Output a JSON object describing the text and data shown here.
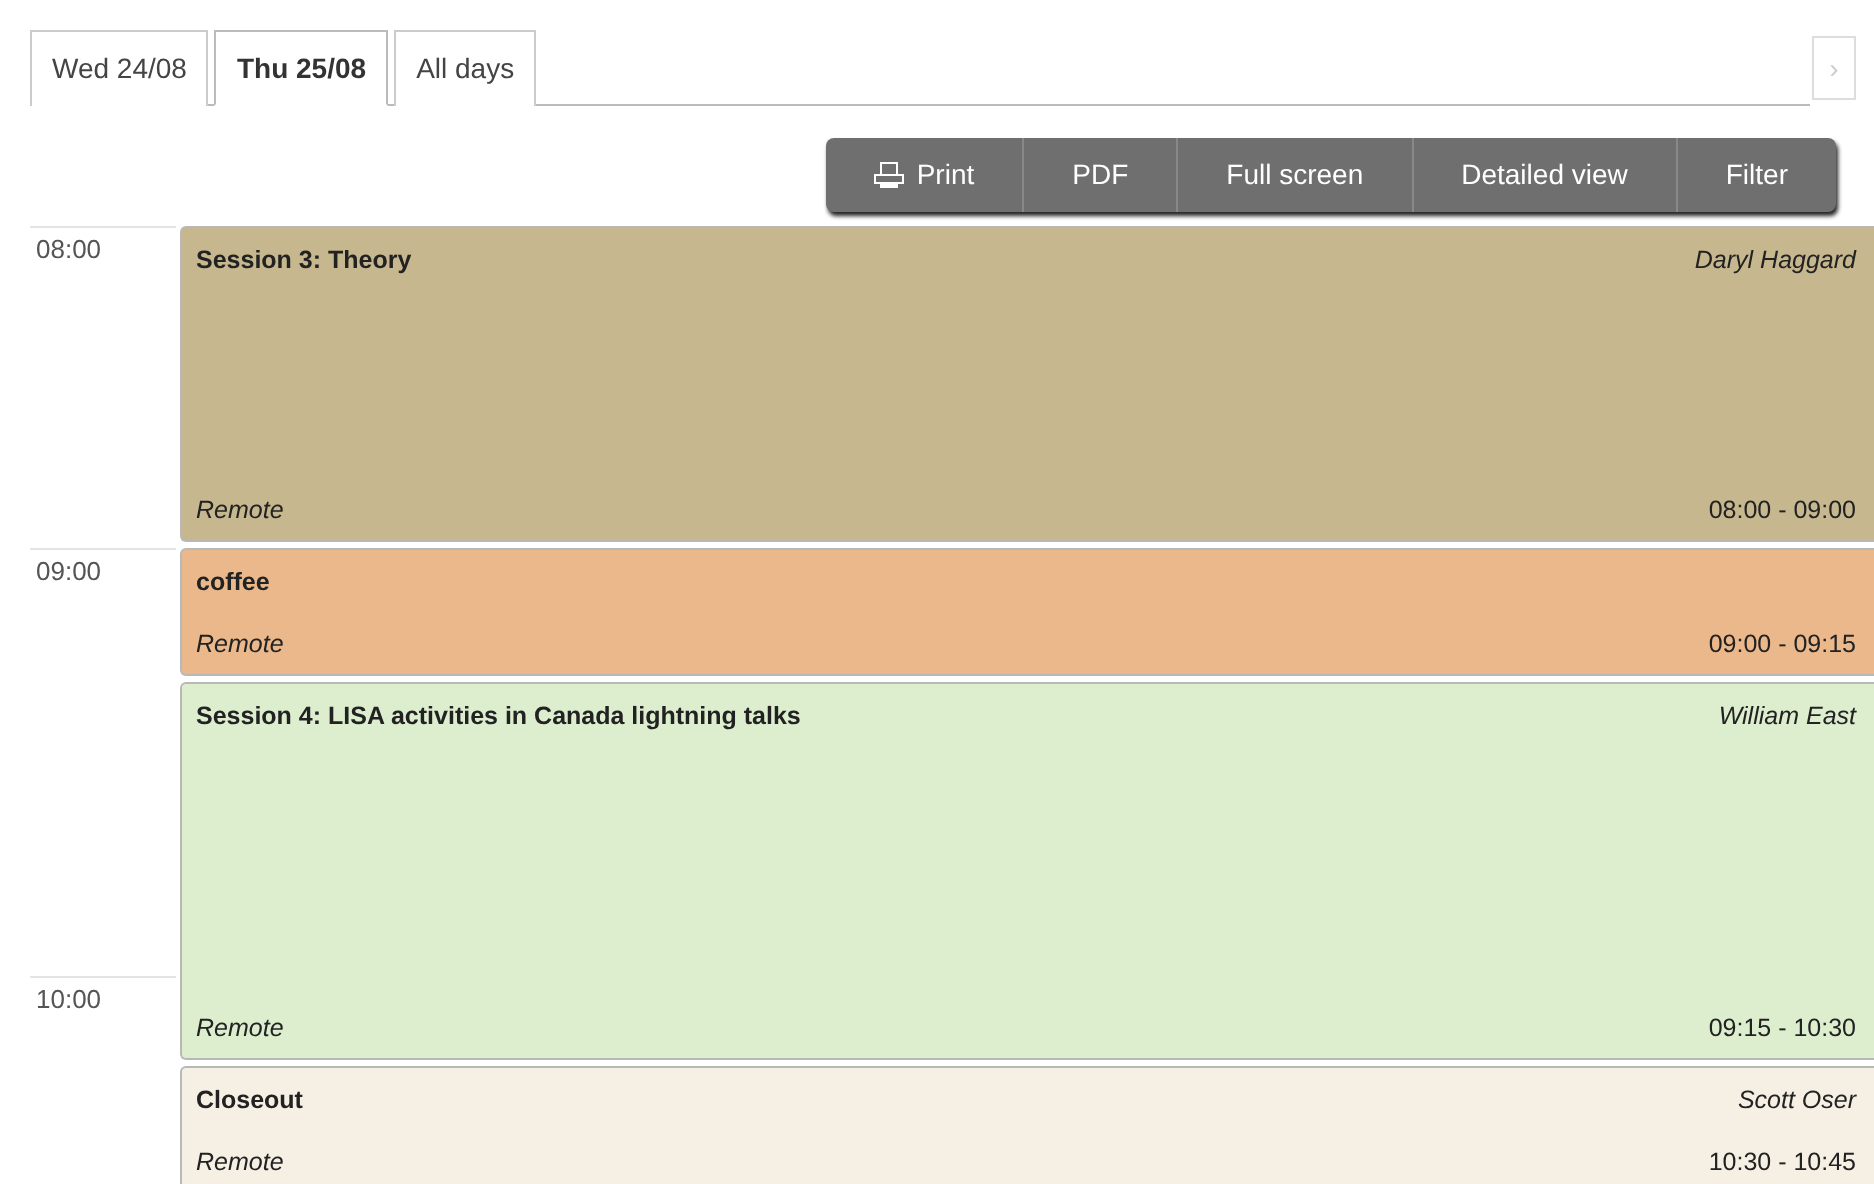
{
  "day_tabs": [
    {
      "label": "Wed 24/08",
      "selected": false
    },
    {
      "label": "Thu 25/08",
      "selected": true
    },
    {
      "label": "All days",
      "selected": false
    }
  ],
  "next_arrow": {
    "label": "›",
    "disabled": true
  },
  "toolbar": [
    {
      "label": "Print",
      "kind": "print"
    },
    {
      "label": "PDF",
      "kind": "plain"
    },
    {
      "label": "Full screen",
      "kind": "plain"
    },
    {
      "label": "Detailed view",
      "kind": "plain"
    },
    {
      "label": "Filter",
      "kind": "plain"
    }
  ],
  "hours": [
    "08:00",
    "09:00",
    "10:00"
  ],
  "entries": [
    {
      "title": "Session 3: Theory",
      "speaker": "Daryl Haggard",
      "location": "Remote",
      "time": "08:00 - 09:00",
      "color": "#c6b78e"
    },
    {
      "title": "coffee",
      "location": "Remote",
      "time": "09:00 - 09:15",
      "color": "#ebb88b"
    },
    {
      "title": "Session 4: LISA activities in Canada lightning talks",
      "speaker": "William East",
      "location": "Remote",
      "time": "09:15 - 10:30",
      "color": "#ddeecf"
    },
    {
      "title": "Closeout",
      "speaker": "Scott Oser",
      "location": "Remote",
      "time": "10:30 - 10:45",
      "color": "#f5efe4"
    }
  ]
}
